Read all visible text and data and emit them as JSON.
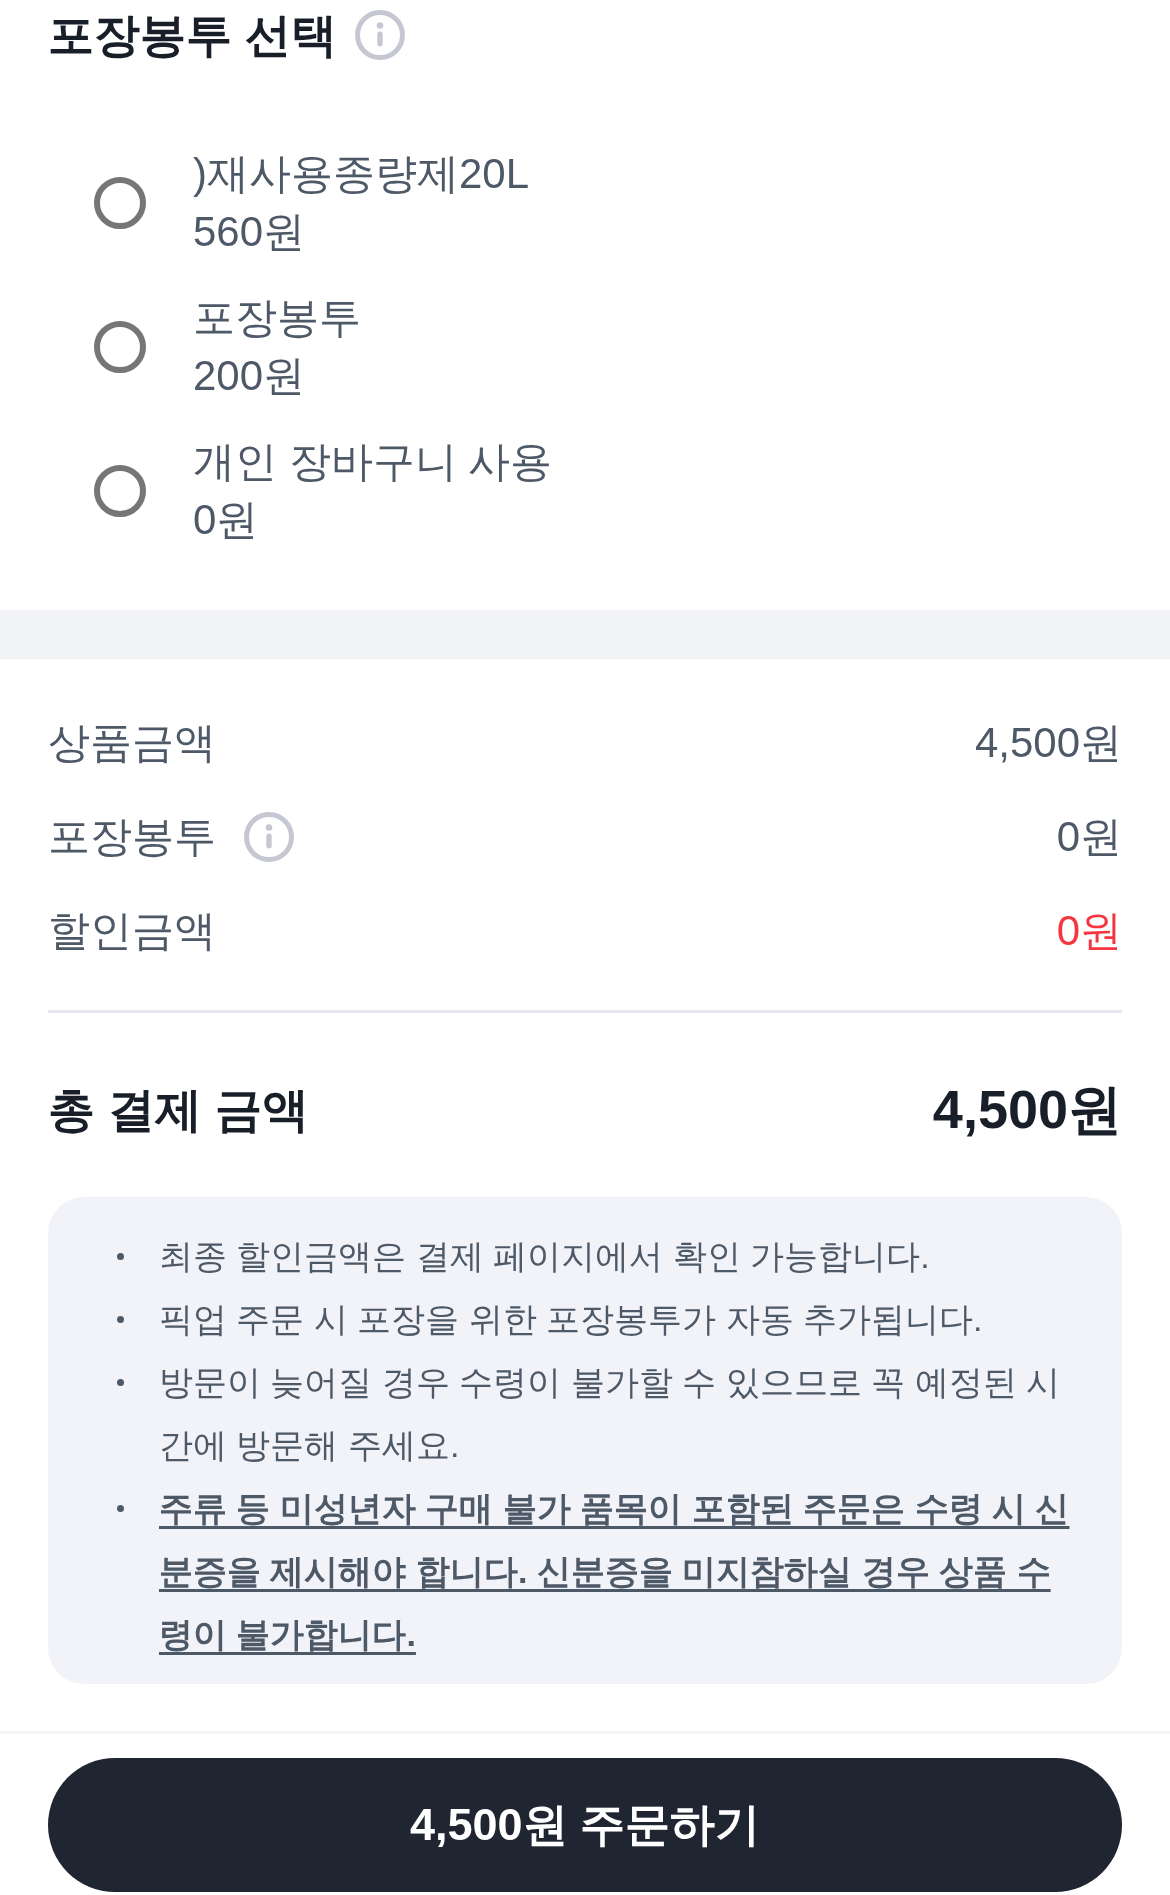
{
  "packaging": {
    "title": "포장봉투 선택",
    "options": [
      {
        "name": ")재사용종량제20L",
        "price": "560원",
        "selected": false
      },
      {
        "name": "포장봉투",
        "price": "200원",
        "selected": false
      },
      {
        "name": "개인 장바구니 사용",
        "price": "0원",
        "selected": false
      }
    ]
  },
  "summary": {
    "rows": [
      {
        "kind": "plain",
        "label": "상품금액",
        "value": "4,500원"
      },
      {
        "kind": "info",
        "label": "포장봉투",
        "value": "0원"
      },
      {
        "kind": "discount",
        "label": "할인금액",
        "value": "0원"
      }
    ]
  },
  "total": {
    "label": "총 결제 금액",
    "value": "4,500원"
  },
  "notices": [
    {
      "text": "최종 할인금액은 결제 페이지에서 확인 가능합니다.",
      "emphasis": false
    },
    {
      "text": "픽업 주문 시 포장을 위한 포장봉투가 자동 추가됩니다.",
      "emphasis": false
    },
    {
      "text": "방문이 늦어질 경우 수령이 불가할 수 있으므로 꼭 예정된 시간에 방문해 주세요.",
      "emphasis": false
    },
    {
      "text": "주류 등 미성년자 구매 불가 품목이 포함된 주문은 수령 시 신분증을 제시해야 합니다. 신분증을 미지참하실 경우 상품 수령이 불가합니다.",
      "emphasis": true
    }
  ],
  "order_button": {
    "label": "4,500원 주문하기"
  }
}
